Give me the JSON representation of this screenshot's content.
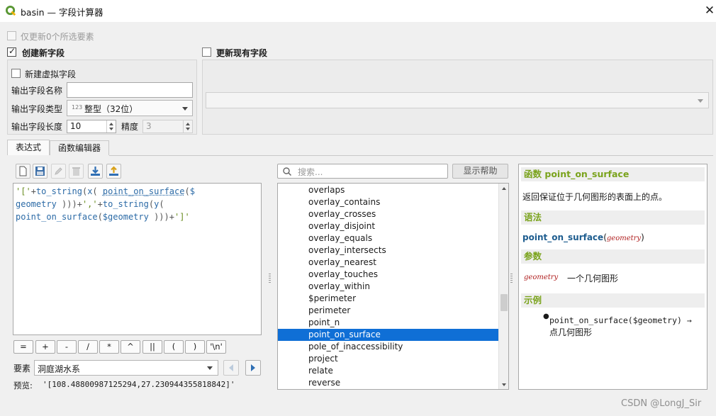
{
  "window": {
    "title": "basin — 字段计算器",
    "close_label": "✕"
  },
  "top": {
    "update_selected_label": "仅更新0个所选要素",
    "create_new_label": "创建新字段",
    "update_existing_label": "更新现有字段"
  },
  "new_field": {
    "virtual_label": "新建虚拟字段",
    "name_label": "输出字段名称",
    "name_value": "",
    "type_label": "输出字段类型",
    "type_icon": "123",
    "type_value": "整型（32位）",
    "length_label": "输出字段长度",
    "length_value": "10",
    "precision_label": "精度",
    "precision_value": "3"
  },
  "tabs": [
    "表达式",
    "函数编辑器"
  ],
  "expression": {
    "line1": [
      {
        "t": "'['",
        "c": "c-str"
      },
      {
        "t": "+",
        "c": "c-op"
      },
      {
        "t": "to_string",
        "c": "c-fn"
      },
      {
        "t": "(",
        "c": "c-op"
      },
      {
        "t": "x",
        "c": "c-fn"
      },
      {
        "t": "( ",
        "c": "c-op"
      },
      {
        "t": "point_on_surface",
        "c": "c-fn ul"
      },
      {
        "t": "(",
        "c": "c-op"
      },
      {
        "t": "$",
        "c": "c-fn"
      }
    ],
    "line2": [
      {
        "t": "geometry",
        "c": "c-fn"
      },
      {
        "t": " )))",
        "c": "c-op"
      },
      {
        "t": "+",
        "c": "c-op"
      },
      {
        "t": "','",
        "c": "c-str"
      },
      {
        "t": "+",
        "c": "c-op"
      },
      {
        "t": "to_string",
        "c": "c-fn"
      },
      {
        "t": "(",
        "c": "c-op"
      },
      {
        "t": "y",
        "c": "c-fn"
      },
      {
        "t": "(",
        "c": "c-op"
      }
    ],
    "line3": [
      {
        "t": "point_on_surface",
        "c": "c-fn"
      },
      {
        "t": "(",
        "c": "c-op"
      },
      {
        "t": "$geometry",
        "c": "c-fn"
      },
      {
        "t": " )))",
        "c": "c-op"
      },
      {
        "t": "+",
        "c": "c-op"
      },
      {
        "t": "']'",
        "c": "c-str"
      }
    ]
  },
  "operators": [
    "=",
    "+",
    "-",
    "/",
    "*",
    "^",
    "||",
    "(",
    ")",
    "'\\n'"
  ],
  "feature": {
    "label": "要素",
    "value": "洞庭湖水系"
  },
  "preview": {
    "label": "预览:",
    "value": "'[108.48800987125294,27.230944355818842]'"
  },
  "search": {
    "placeholder": "搜索...",
    "show_help_label": "显示帮助"
  },
  "functions": [
    "overlaps",
    "overlay_contains",
    "overlay_crosses",
    "overlay_disjoint",
    "overlay_equals",
    "overlay_intersects",
    "overlay_nearest",
    "overlay_touches",
    "overlay_within",
    "$perimeter",
    "perimeter",
    "point_n",
    "point_on_surface",
    "pole_of_inaccessibility",
    "project",
    "relate",
    "reverse"
  ],
  "selected_function": "point_on_surface",
  "help": {
    "title_prefix": "函数",
    "title_fn": "point_on_surface",
    "description": "返回保证位于几何图形的表面上的点。",
    "syntax_head": "语法",
    "syntax_fn": "point_on_surface",
    "syntax_arg": "geometry",
    "params_head": "参数",
    "param_name": "geometry",
    "param_desc": "一个几何图形",
    "examples_head": "示例",
    "example_code": "point_on_surface($geometry) →",
    "example_desc": "点几何图形"
  },
  "watermark": "CSDN @LongJ_Sir",
  "colors": {
    "selection": "#0f6fd6",
    "help_heading": "#7aa31c",
    "function_blue": "#1e5d8f"
  }
}
